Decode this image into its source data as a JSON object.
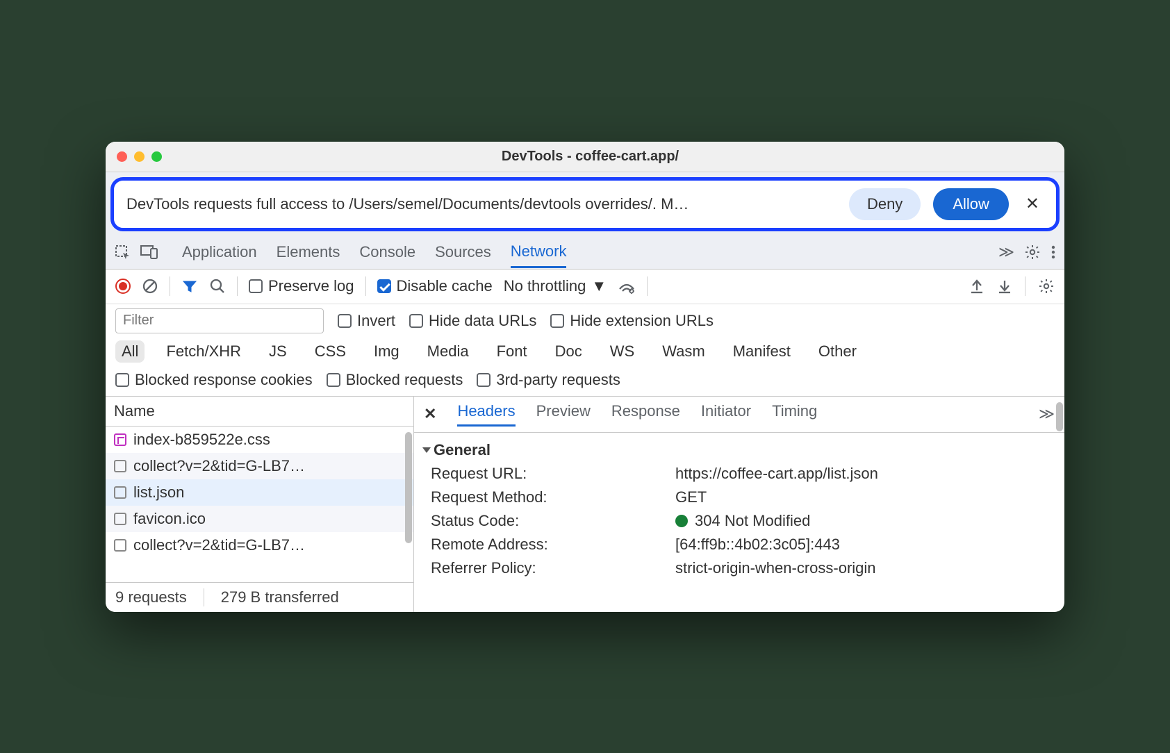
{
  "window": {
    "title": "DevTools - coffee-cart.app/"
  },
  "infobar": {
    "text": "DevTools requests full access to /Users/semel/Documents/devtools overrides/. M…",
    "deny": "Deny",
    "allow": "Allow"
  },
  "panel_tabs": [
    "Application",
    "Elements",
    "Console",
    "Sources",
    "Network"
  ],
  "panel_active": "Network",
  "toolbar": {
    "preserve_log": "Preserve log",
    "disable_cache": "Disable cache",
    "throttle": "No throttling"
  },
  "filter": {
    "placeholder": "Filter",
    "invert": "Invert",
    "hide_data": "Hide data URLs",
    "hide_ext": "Hide extension URLs"
  },
  "types": [
    "All",
    "Fetch/XHR",
    "JS",
    "CSS",
    "Img",
    "Media",
    "Font",
    "Doc",
    "WS",
    "Wasm",
    "Manifest",
    "Other"
  ],
  "more_filters": {
    "blocked_cookies": "Blocked response cookies",
    "blocked_req": "Blocked requests",
    "third_party": "3rd-party requests"
  },
  "name_header": "Name",
  "files": [
    {
      "name": "index-b859522e.css",
      "kind": "css"
    },
    {
      "name": "collect?v=2&tid=G-LB7…",
      "kind": "sq"
    },
    {
      "name": "list.json",
      "kind": "sq",
      "selected": true
    },
    {
      "name": "favicon.ico",
      "kind": "sq"
    },
    {
      "name": "collect?v=2&tid=G-LB7…",
      "kind": "sq"
    }
  ],
  "footer": {
    "requests": "9 requests",
    "transferred": "279 B transferred"
  },
  "detail_tabs": [
    "Headers",
    "Preview",
    "Response",
    "Initiator",
    "Timing"
  ],
  "general": {
    "title": "General",
    "rows": [
      {
        "k": "Request URL:",
        "v": "https://coffee-cart.app/list.json"
      },
      {
        "k": "Request Method:",
        "v": "GET"
      },
      {
        "k": "Status Code:",
        "v": "304 Not Modified",
        "status": true
      },
      {
        "k": "Remote Address:",
        "v": "[64:ff9b::4b02:3c05]:443"
      },
      {
        "k": "Referrer Policy:",
        "v": "strict-origin-when-cross-origin"
      }
    ]
  }
}
